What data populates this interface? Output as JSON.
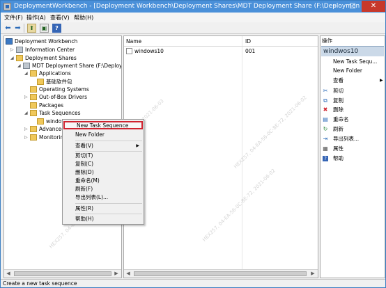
{
  "window": {
    "title": "DeploymentWorkbench - [Deployment Workbench\\Deployment Shares\\MDT Deployment Share (F:\\Deploymen",
    "minimize_glyph": "–",
    "maximize_glyph": "□",
    "close_glyph": "✕"
  },
  "menu": {
    "file": "文件(F)",
    "action": "操作(A)",
    "view": "查看(V)",
    "help": "帮助(H)"
  },
  "toolbar": {
    "back_glyph": "⬅",
    "forward_glyph": "➡",
    "up_glyph": "⬆",
    "show_glyph": "▣",
    "help_glyph": "?"
  },
  "tree": {
    "root": "Deployment Workbench",
    "info_center": "Information Center",
    "deployment_shares": "Deployment Shares",
    "mdt_share": "MDT Deployment Share (F:\\Deployme",
    "applications": "Applications",
    "app_sub": "基础软件包",
    "operating_systems": "Operating Systems",
    "drivers": "Out-of-Box Drivers",
    "packages": "Packages",
    "task_sequences": "Task Sequences",
    "windows_item": "windows10",
    "advanced": "Advanced",
    "monitoring": "Monitoring",
    "expand_open": "◢",
    "expand_closed": "▷"
  },
  "list": {
    "columns": [
      "Name",
      "ID"
    ],
    "rows": [
      {
        "name": "windows10",
        "id": "001"
      }
    ]
  },
  "actions": {
    "header": "操作",
    "section": "windwos10",
    "items": [
      {
        "label": "New Task Sequ...",
        "icon": ""
      },
      {
        "label": "New Folder",
        "icon": ""
      },
      {
        "label": "查看",
        "icon": "",
        "submenu": "▶"
      },
      {
        "label": "剪切",
        "icon": "✂"
      },
      {
        "label": "复制",
        "icon": "⧉"
      },
      {
        "label": "删除",
        "icon": "✖"
      },
      {
        "label": "重命名",
        "icon": "▤"
      },
      {
        "label": "刷新",
        "icon": "↻"
      },
      {
        "label": "导出列表...",
        "icon": "⇥"
      },
      {
        "label": "属性",
        "icon": "▦"
      },
      {
        "label": "帮助",
        "icon": "?"
      }
    ],
    "colors": {
      "delete": "#d0232f",
      "accent": "#2a6ab8"
    }
  },
  "context_menu": {
    "items": [
      "New Task Sequence",
      "New Folder",
      "查看(V)",
      "剪切(T)",
      "复制(C)",
      "删除(D)",
      "重命名(M)",
      "刷新(F)",
      "导出列表(L)...",
      "属性(R)",
      "帮助(H)"
    ],
    "submenu_glyph": "▶",
    "highlight_color": "#d0232f"
  },
  "status": {
    "text": "Create a new task sequence"
  },
  "scroll": {
    "left_glyph": "◀",
    "right_glyph": "▶"
  },
  "watermark": {
    "a": "HEX257, 04-EA-56-0C-8E-72, 2021-06-03",
    "b": "HEX257, 04-EA-56-0C-8E-72, 2021-06-02"
  }
}
